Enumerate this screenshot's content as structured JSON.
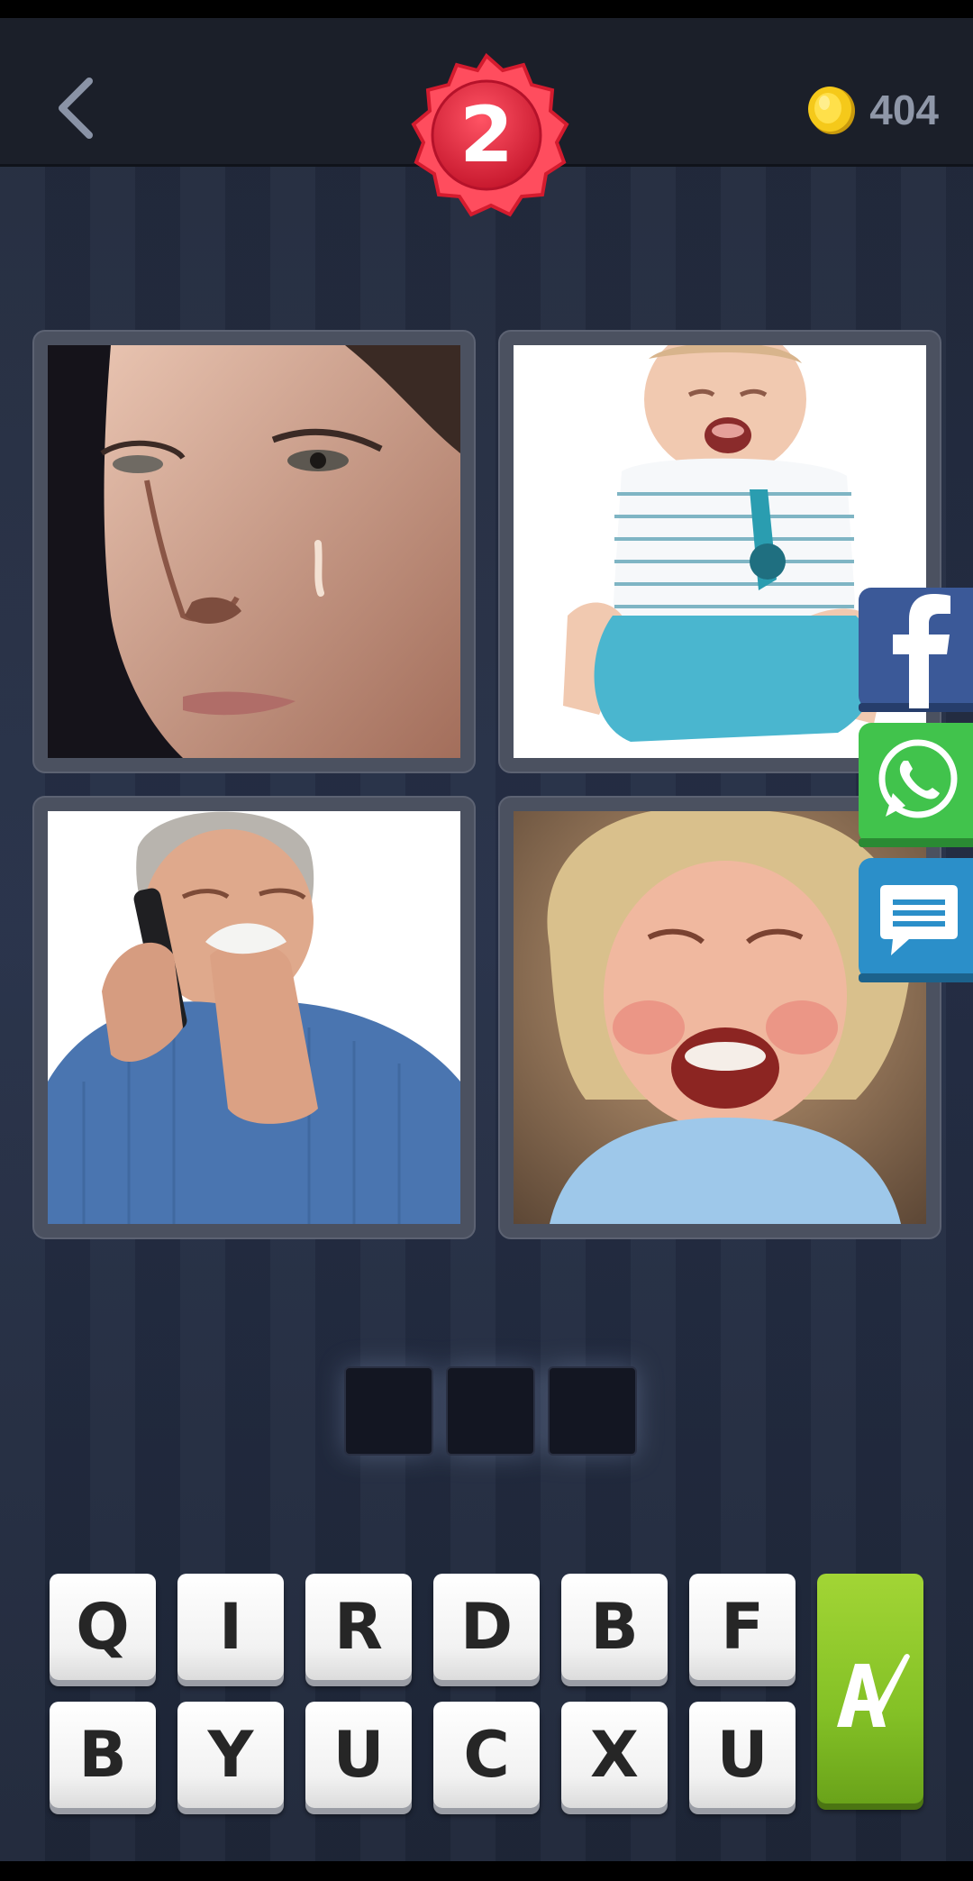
{
  "header": {
    "level": "2",
    "coins": "404"
  },
  "puzzle": {
    "pictures": [
      {
        "icon": "crying-woman-picture"
      },
      {
        "icon": "crying-baby-sitting-picture"
      },
      {
        "icon": "man-wiping-tears-on-phone-picture"
      },
      {
        "icon": "crying-toddler-picture"
      }
    ],
    "answer_slots": [
      "",
      "",
      ""
    ]
  },
  "keyboard": {
    "row1": [
      "Q",
      "I",
      "R",
      "D",
      "B",
      "F"
    ],
    "row2": [
      "B",
      "Y",
      "U",
      "C",
      "X",
      "U"
    ],
    "hint_icon": "brush-letter-a-icon"
  },
  "share": [
    {
      "icon": "facebook-icon",
      "color": "#3b5998"
    },
    {
      "icon": "whatsapp-icon",
      "color": "#41c34c"
    },
    {
      "icon": "message-icon",
      "color": "#2b8fc9"
    }
  ],
  "colors": {
    "badge": "#e22535",
    "hint": "#8ac82a",
    "coin": "#f5c91a"
  }
}
